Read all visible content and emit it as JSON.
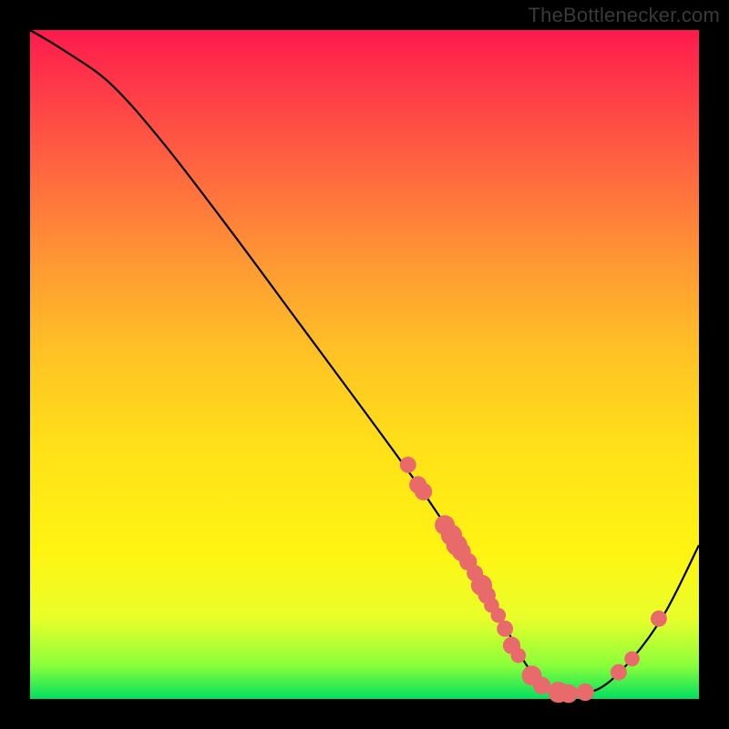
{
  "watermark": "TheBottlenecker.com",
  "chart_data": {
    "type": "line",
    "title": "",
    "xlabel": "",
    "ylabel": "",
    "xlim": [
      0,
      100
    ],
    "ylim": [
      0,
      100
    ],
    "note": "Axes are unlabeled in the source image; values are relative percentages estimated from pixel positions. Y=0 is bottom (green), Y=100 is top (red).",
    "series": [
      {
        "name": "curve",
        "x": [
          0,
          5,
          12,
          20,
          30,
          40,
          50,
          58,
          64,
          70,
          73,
          76,
          80,
          85,
          90,
          95,
          100
        ],
        "y": [
          100,
          97,
          92,
          83,
          70,
          56.5,
          43,
          32,
          23,
          13,
          7,
          3,
          1,
          1.5,
          6,
          13,
          23
        ]
      }
    ],
    "markers": {
      "name": "highlight-points",
      "note": "Pink circular markers overlaid on the curve at sampled positions.",
      "points": [
        {
          "x": 56.5,
          "y": 35.0,
          "r": 0.9
        },
        {
          "x": 58.0,
          "y": 32.0,
          "r": 1.0
        },
        {
          "x": 58.8,
          "y": 31.0,
          "r": 1.0
        },
        {
          "x": 62.0,
          "y": 26.0,
          "r": 1.2
        },
        {
          "x": 63.0,
          "y": 24.5,
          "r": 1.3
        },
        {
          "x": 63.8,
          "y": 23.0,
          "r": 1.3
        },
        {
          "x": 64.5,
          "y": 22.0,
          "r": 1.1
        },
        {
          "x": 65.5,
          "y": 20.5,
          "r": 1.0
        },
        {
          "x": 66.5,
          "y": 18.8,
          "r": 0.9
        },
        {
          "x": 67.5,
          "y": 17.0,
          "r": 1.3
        },
        {
          "x": 68.3,
          "y": 15.5,
          "r": 1.0
        },
        {
          "x": 69.0,
          "y": 14.0,
          "r": 0.8
        },
        {
          "x": 70.0,
          "y": 12.5,
          "r": 0.8
        },
        {
          "x": 71.0,
          "y": 10.5,
          "r": 0.9
        },
        {
          "x": 72.0,
          "y": 8.0,
          "r": 1.0
        },
        {
          "x": 73.0,
          "y": 6.5,
          "r": 0.8
        },
        {
          "x": 75.0,
          "y": 3.5,
          "r": 1.2
        },
        {
          "x": 76.5,
          "y": 2.0,
          "r": 1.0
        },
        {
          "x": 79.0,
          "y": 1.0,
          "r": 1.3
        },
        {
          "x": 80.5,
          "y": 0.8,
          "r": 1.1
        },
        {
          "x": 83.0,
          "y": 1.0,
          "r": 1.0
        },
        {
          "x": 88.0,
          "y": 4.0,
          "r": 0.9
        },
        {
          "x": 90.0,
          "y": 6.0,
          "r": 0.8
        },
        {
          "x": 94.0,
          "y": 12.0,
          "r": 0.9
        }
      ]
    },
    "gradient_stops": [
      {
        "pos": 0,
        "color": "#ff1a4d"
      },
      {
        "pos": 10,
        "color": "#ff3f47"
      },
      {
        "pos": 22,
        "color": "#ff6a3f"
      },
      {
        "pos": 35,
        "color": "#ff9933"
      },
      {
        "pos": 48,
        "color": "#ffc125"
      },
      {
        "pos": 62,
        "color": "#ffe019"
      },
      {
        "pos": 78,
        "color": "#fff412"
      },
      {
        "pos": 88,
        "color": "#e8ff2a"
      },
      {
        "pos": 95,
        "color": "#8aff3a"
      },
      {
        "pos": 100,
        "color": "#00e060"
      }
    ],
    "colors": {
      "curve": "#000000",
      "marker": "#e86a6a",
      "frame": "#000000"
    }
  }
}
